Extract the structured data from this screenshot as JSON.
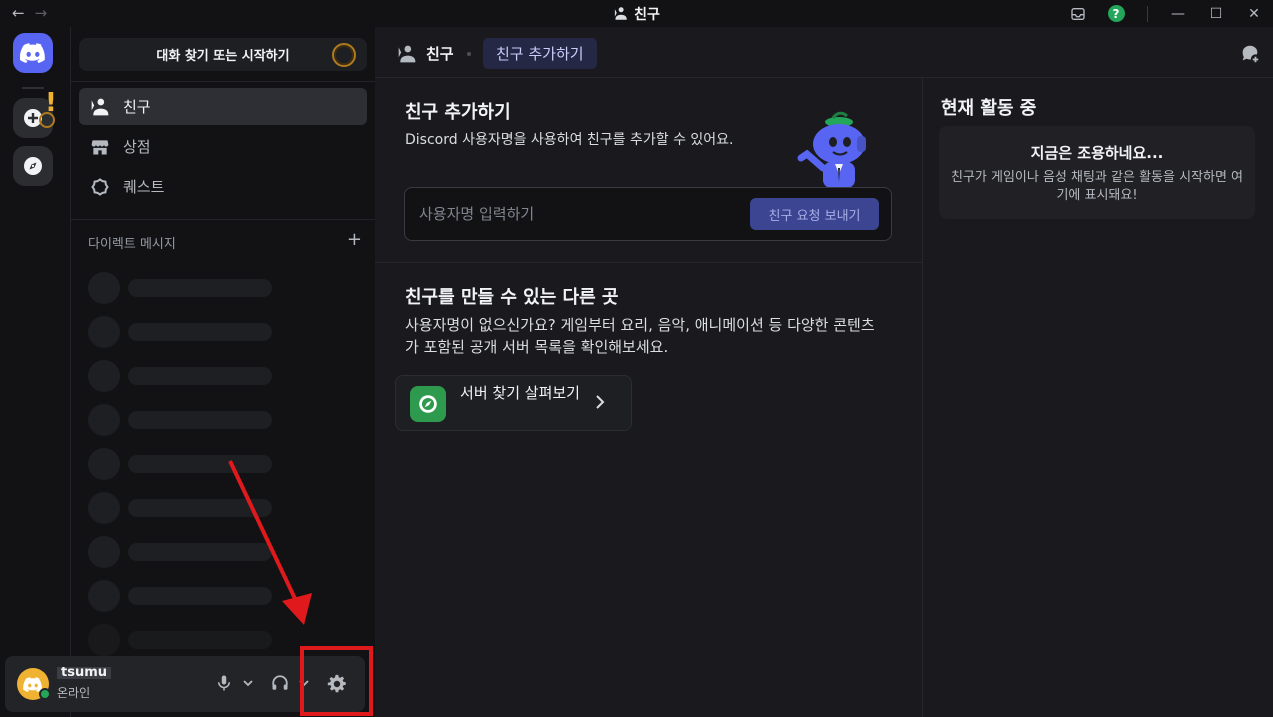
{
  "window": {
    "title": "친구",
    "back_glyph": "←",
    "forward_glyph": "→"
  },
  "sidebar": {
    "search_label": "대화 찾기 또는 시작하기",
    "nav": [
      {
        "label": "친구",
        "icon": "friends-icon",
        "active": true
      },
      {
        "label": "상점",
        "icon": "shop-icon",
        "active": false
      },
      {
        "label": "퀘스트",
        "icon": "quests-icon",
        "active": false
      }
    ],
    "dm_header": "다이렉트 메시지",
    "dm_add_glyph": "+"
  },
  "user_panel": {
    "username": "tsumu",
    "status_text": "온라인",
    "status_color": "#23a55a"
  },
  "topbar": {
    "friends_label": "친구",
    "add_friend_tab": "친구 추가하기"
  },
  "add_friend": {
    "title": "친구 추가하기",
    "description": "Discord 사용자명을 사용하여 친구를 추가할 수 있어요.",
    "input_placeholder": "사용자명 입력하기",
    "send_button": "친구 요청 보내기"
  },
  "other_places": {
    "title": "친구를 만들 수 있는 다른 곳",
    "description": "사용자명이 없으신가요? 게임부터 요리, 음악, 애니메이션 등 다양한 콘텐츠가 포함된 공개 서버 목록을 확인해보세요.",
    "explore_button": "서버 찾기 살펴보기"
  },
  "activity": {
    "title": "현재 활동 중",
    "empty_title": "지금은 조용하네요...",
    "empty_desc": "친구가 게임이나 음성 채팅과 같은 활동을 시작하면 여기에 표시돼요!"
  },
  "colors": {
    "brand": "#5865f2",
    "highlight": "#e0191c",
    "explore_green": "#2e9a4e"
  }
}
